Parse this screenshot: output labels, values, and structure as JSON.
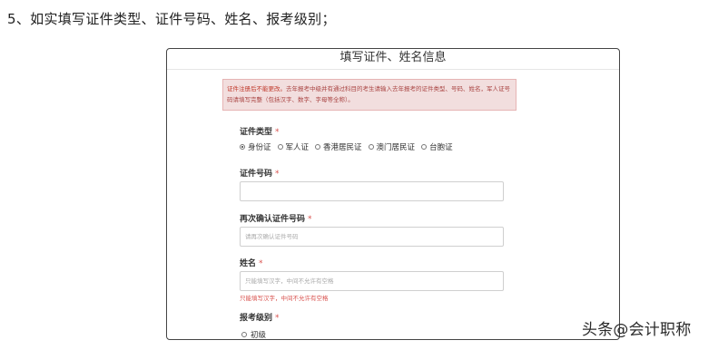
{
  "heading": "5、如实填写证件类型、证件号码、姓名、报考级别；",
  "form": {
    "title": "填写证件、姓名信息",
    "notice_strong": "证件注册后不能更改。",
    "notice_text": "去年报考中级并有通过科目的考生请输入去年报考的证件类型、号码、姓名，军人证号码请填写完整（包括汉字、数字、字母等全称）。",
    "id_type": {
      "label": "证件类型",
      "required_mark": "*",
      "options": [
        "身份证",
        "军人证",
        "香港居民证",
        "澳门居民证",
        "台胞证"
      ],
      "selected": "身份证"
    },
    "id_number": {
      "label": "证件号码",
      "required_mark": "*",
      "value": "",
      "placeholder": ""
    },
    "id_confirm": {
      "label": "再次确认证件号码",
      "required_mark": "*",
      "placeholder": "请再次确认证件号码"
    },
    "name": {
      "label": "姓名",
      "required_mark": "*",
      "placeholder": "只能填写汉字，中间不允许有空格",
      "error": "只能填写汉字，中间不允许有空格"
    },
    "level": {
      "label": "报考级别",
      "required_mark": "*",
      "options": [
        "初级"
      ]
    }
  },
  "watermark": "头条@会计职称"
}
